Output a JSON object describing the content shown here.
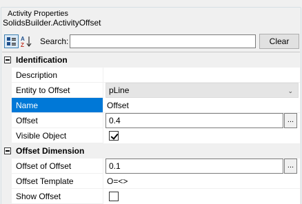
{
  "panel": {
    "title": "Activity Properties",
    "class_name": "SolidsBuilder.ActivityOffset"
  },
  "toolbar": {
    "categorized_icon": "categorized-view-icon",
    "alphabetical_icon": "alphabetical-sort-icon",
    "search_label": "Search:",
    "search_value": "",
    "clear_label": "Clear"
  },
  "grid": {
    "categories": [
      {
        "label": "Identification",
        "properties": [
          {
            "name": "Description",
            "value": ""
          },
          {
            "name": "Entity to Offset",
            "value": "pLine"
          },
          {
            "name": "Name",
            "value": "Offset"
          },
          {
            "name": "Offset",
            "value": "0.4"
          },
          {
            "name": "Visible Object",
            "value": "checked"
          }
        ]
      },
      {
        "label": "Offset Dimension",
        "properties": [
          {
            "name": "Offset of Offset",
            "value": "0.1"
          },
          {
            "name": "Offset Template",
            "value": "O=<>"
          },
          {
            "name": "Show Offset",
            "value": "unchecked"
          }
        ]
      }
    ],
    "ellipsis_label": "...",
    "selected_property": "Name"
  },
  "colors": {
    "selection": "#0078d7",
    "category_background": "#f0f0f0"
  }
}
